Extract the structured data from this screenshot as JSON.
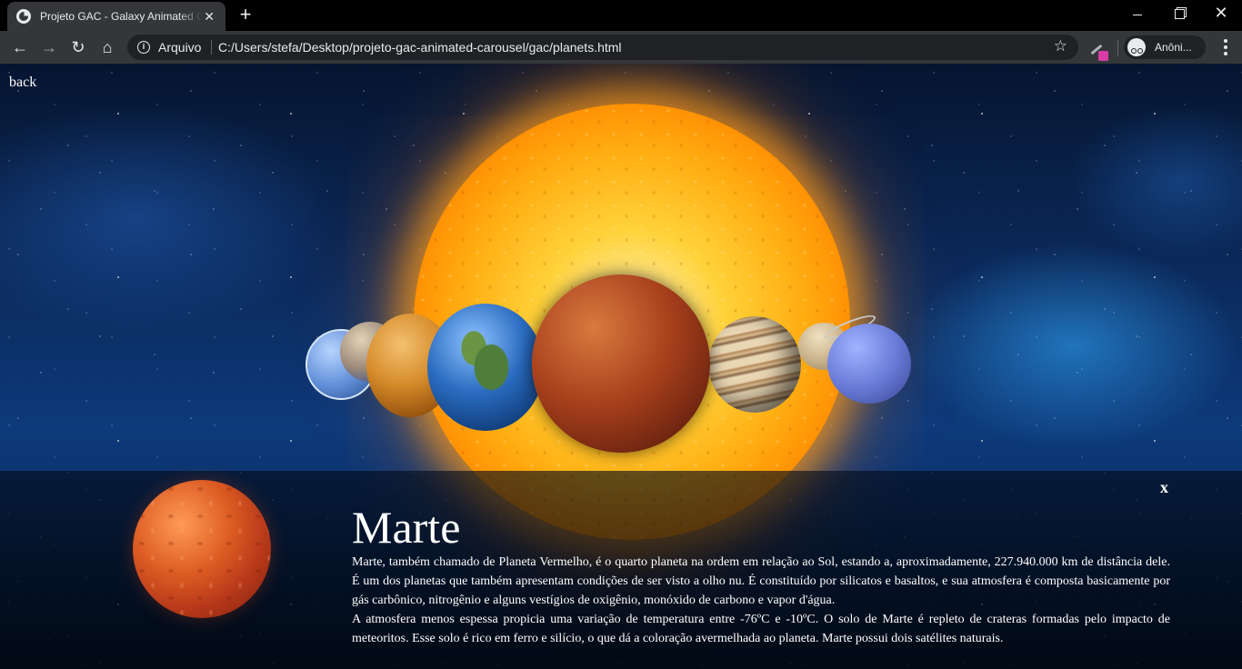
{
  "browser": {
    "tab_title": "Projeto GAC - Galaxy Animated Carousel",
    "tab_close": "✕",
    "new_tab": "+",
    "scheme_label": "Arquivo",
    "url": "C:/Users/stefa/Desktop/projeto-gac-animated-carousel/gac/planets.html",
    "profile_label": "Anôni..."
  },
  "page": {
    "back_label": "back",
    "close_label": "x",
    "planet": {
      "name": "Marte",
      "paragraphs": [
        "Marte, também chamado de Planeta Vermelho, é o quarto planeta na ordem em relação ao Sol, estando a, aproximadamente, 227.940.000 km de distância dele. É um dos planetas que também apresentam condições de ser visto a olho nu. É constituído por silicatos e basaltos, e sua atmosfera é composta basicamente por gás carbônico, nitrogênio e alguns vestígios de oxigênio, monóxido de carbono e vapor d'água.",
        "A atmosfera menos espessa propicia uma variação de temperatura entre -76ºC e -10ºC. O solo de Marte é repleto de crateras formadas pelo impacto de meteoritos. Esse solo é rico em ferro e silício, o que dá a coloração avermelhada ao planeta. Marte possui dois satélites naturais."
      ]
    }
  },
  "colors": {
    "chrome_bg": "#000000",
    "toolbar_bg": "#35363a",
    "omnibox_bg": "#202124",
    "text": "#e8eaed",
    "extension_badge": "#d93ca6"
  }
}
